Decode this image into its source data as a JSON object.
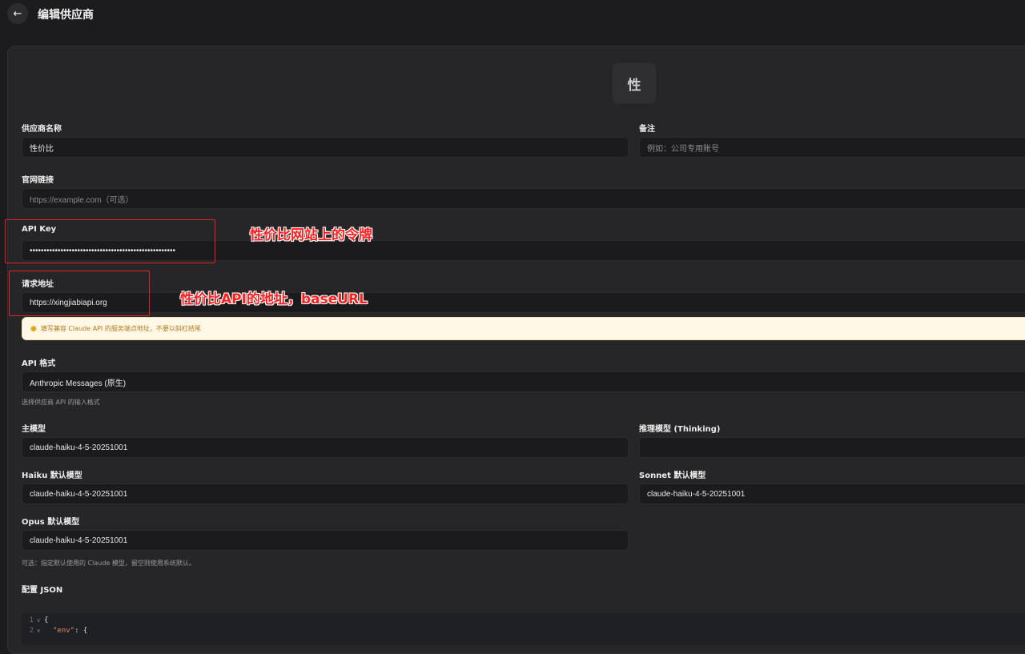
{
  "header": {
    "back_icon": "arrow-left-icon",
    "title": "编辑供应商"
  },
  "avatar": {
    "letter": "性"
  },
  "form": {
    "provider_name": {
      "label": "供应商名称",
      "value": "性价比"
    },
    "note": {
      "label": "备注",
      "placeholder": "例如：公司专用账号"
    },
    "website": {
      "label": "官网链接",
      "placeholder": "https://example.com（可选）"
    },
    "api_key": {
      "label": "API Key",
      "value": "••••••••••••••••••••••••••••••••••••••••••••••••••••"
    },
    "request_url": {
      "label": "请求地址",
      "value": "https://xingjiabiapi.org"
    },
    "notice": {
      "icon": "lightbulb-icon",
      "text": "填写兼容 Claude API 的服务端点地址，不要以斜杠结尾"
    },
    "api_format": {
      "label": "API 格式",
      "value": "Anthropic Messages (原生)",
      "hint": "选择供应商 API 的输入格式"
    },
    "main_model": {
      "label": "主模型",
      "value": "claude-haiku-4-5-20251001"
    },
    "reasoning_model": {
      "label": "推理模型 (Thinking)",
      "value": ""
    },
    "haiku_model": {
      "label": "Haiku 默认模型",
      "value": "claude-haiku-4-5-20251001"
    },
    "sonnet_model": {
      "label": "Sonnet 默认模型",
      "value": "claude-haiku-4-5-20251001"
    },
    "opus_model": {
      "label": "Opus 默认模型",
      "value": "claude-haiku-4-5-20251001"
    },
    "models_hint": "可选：指定默认使用的 Claude 模型，留空则使用系统默认。",
    "config_json": {
      "label": "配置 JSON",
      "lines": [
        {
          "num": "1",
          "fold": "v",
          "text": "{"
        },
        {
          "num": "2",
          "fold": "v",
          "key": "\"env\"",
          "rest": ": {"
        }
      ]
    }
  },
  "annotations": {
    "api_key_note": "性价比网站上的令牌",
    "request_url_note": "性价比API的地址，baseURL"
  },
  "colors": {
    "annotation": "#ff1f1f",
    "notice_bg": "#fff8e6",
    "notice_text": "#b8791a",
    "background": "#1c1c1e",
    "panel": "#262628"
  }
}
